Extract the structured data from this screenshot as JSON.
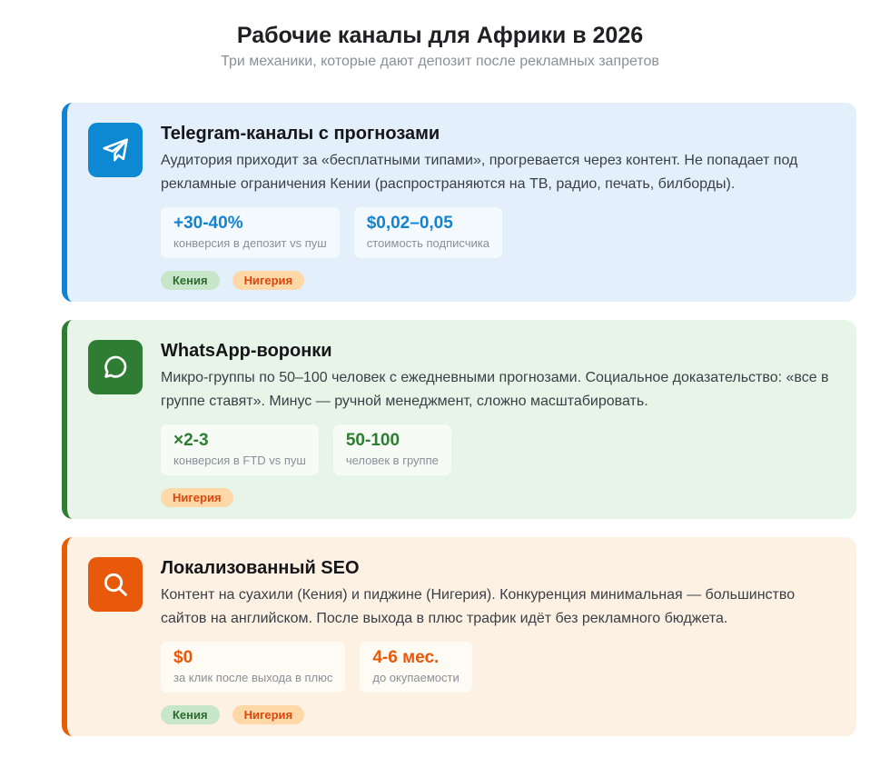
{
  "header": {
    "title": "Рабочие каналы для Африки в 2026",
    "subtitle": "Три механики, которые дают депозит после рекламных запретов"
  },
  "colors": {
    "blue_accent": "#1283d2",
    "green_accent": "#2e7d32",
    "orange_accent": "#e8590c"
  },
  "cards": [
    {
      "icon": "telegram-send-icon",
      "title": "Telegram-каналы с прогнозами",
      "description": "Аудитория приходит за «бесплатными типами», прогревается через контент. Не попадает под рекламные ограничения Кении (распространяются на ТВ, радио, печать, билборды).",
      "stats": [
        {
          "value": "+30-40%",
          "label": "конверсия в депозит vs пуш"
        },
        {
          "value": "$0,02–0,05",
          "label": "стоимость подписчика"
        }
      ],
      "tags": [
        "Кения",
        "Нигерия"
      ]
    },
    {
      "icon": "whatsapp-chat-icon",
      "title": "WhatsApp-воронки",
      "description": "Микро-группы по 50–100 человек с ежедневными прогнозами. Социальное доказательство: «все в группе ставят». Минус — ручной менеджмент, сложно масштабировать.",
      "stats": [
        {
          "value": "×2-3",
          "label": "конверсия в FTD vs пуш"
        },
        {
          "value": "50-100",
          "label": "человек в группе"
        }
      ],
      "tags": [
        "Нигерия"
      ]
    },
    {
      "icon": "search-icon",
      "title": "Локализованный SEO",
      "description": "Контент на суахили (Кения) и пиджине (Нигерия). Конкуренция минимальная — большинство сайтов на английском. После выхода в плюс трафик идёт без рекламного бюджета.",
      "stats": [
        {
          "value": "$0",
          "label": "за клик после выхода в плюс"
        },
        {
          "value": "4-6 мес.",
          "label": "до окупаемости"
        }
      ],
      "tags": [
        "Кения",
        "Нигерия"
      ]
    }
  ]
}
